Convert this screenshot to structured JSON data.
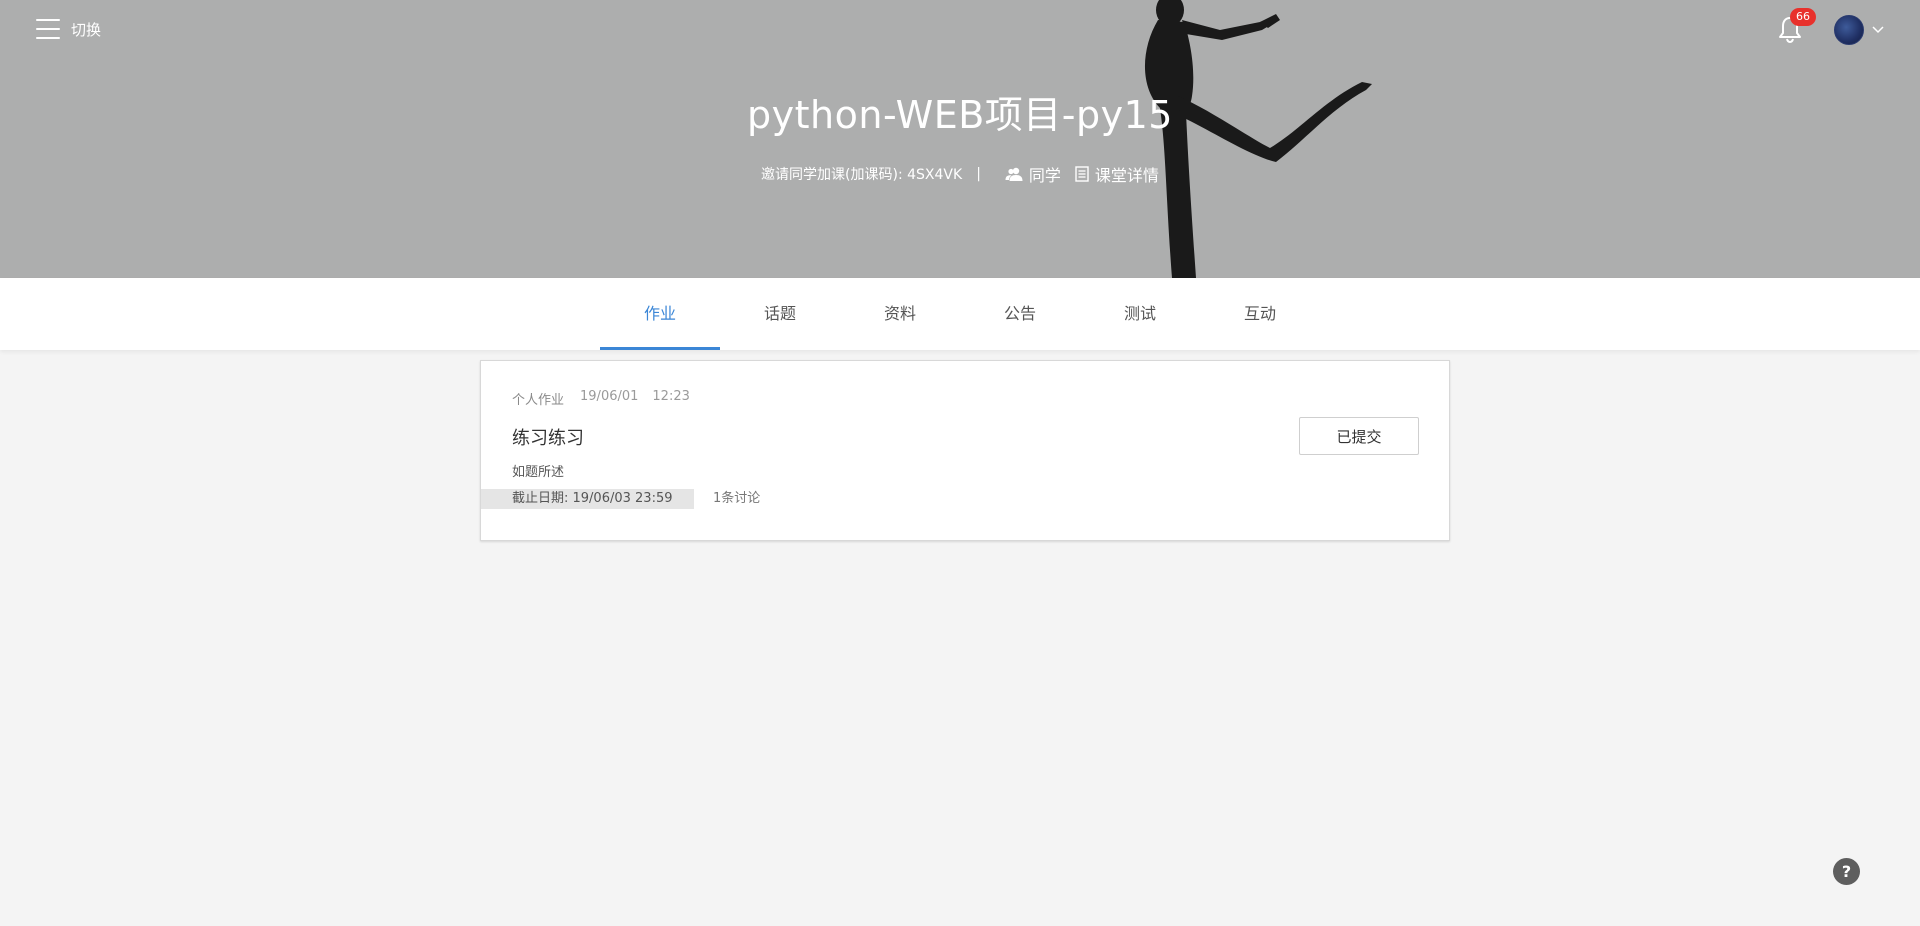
{
  "topbar": {
    "menu_label": "切换",
    "notification_count": "66",
    "menu_icon": "hamburger-icon",
    "bell_icon": "bell-icon",
    "caret_icon": "chevron-down-icon"
  },
  "course": {
    "title": "python-WEB项目-py15",
    "invite_text": "邀请同学加课(加课码): 4SX4VK",
    "separator": "|",
    "classmates_label": "同学",
    "details_label": "课堂详情"
  },
  "tabs": [
    {
      "label": "作业",
      "active": true
    },
    {
      "label": "话题",
      "active": false
    },
    {
      "label": "资料",
      "active": false
    },
    {
      "label": "公告",
      "active": false
    },
    {
      "label": "测试",
      "active": false
    },
    {
      "label": "互动",
      "active": false
    }
  ],
  "homework": {
    "type": "个人作业",
    "date": "19/06/01",
    "time": "12:23",
    "title": "练习练习",
    "description": "如题所述",
    "deadline": "截止日期: 19/06/03  23:59",
    "discussion": "1条讨论",
    "status_button": "已提交"
  },
  "help": {
    "label": "?"
  },
  "colors": {
    "banner": "#adaeae",
    "accent": "#3b86d6",
    "badge": "#e8312c",
    "page_bg": "#f4f4f4"
  }
}
